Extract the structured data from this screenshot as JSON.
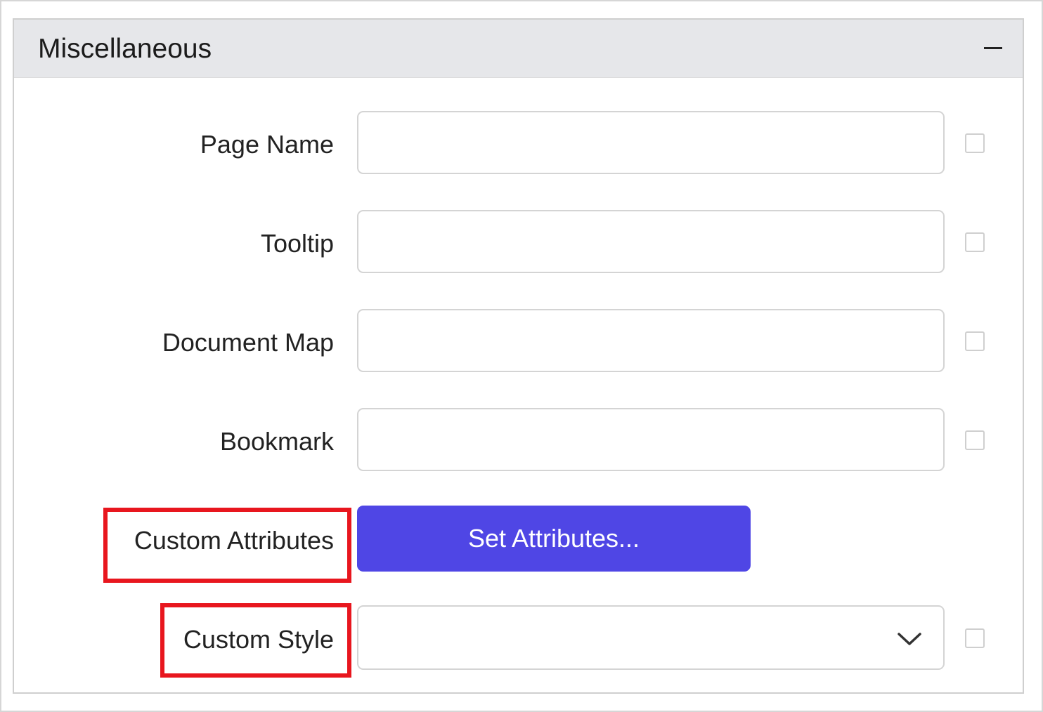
{
  "panel": {
    "title": "Miscellaneous",
    "collapse_icon": "minus-icon"
  },
  "fields": {
    "page_name": {
      "label": "Page Name",
      "value": "",
      "checked": false
    },
    "tooltip": {
      "label": "Tooltip",
      "value": "",
      "checked": false
    },
    "document_map": {
      "label": "Document Map",
      "value": "",
      "checked": false
    },
    "bookmark": {
      "label": "Bookmark",
      "value": "",
      "checked": false
    }
  },
  "custom_attributes": {
    "label": "Custom Attributes",
    "button_label": "Set Attributes..."
  },
  "custom_style": {
    "label": "Custom Style",
    "selected_value": "",
    "dropdown_icon": "chevron-down-icon",
    "checked": false
  },
  "colors": {
    "header_bg": "#e6e7ea",
    "primary_button": "#4f46e5",
    "highlight_border": "#e8161e"
  }
}
